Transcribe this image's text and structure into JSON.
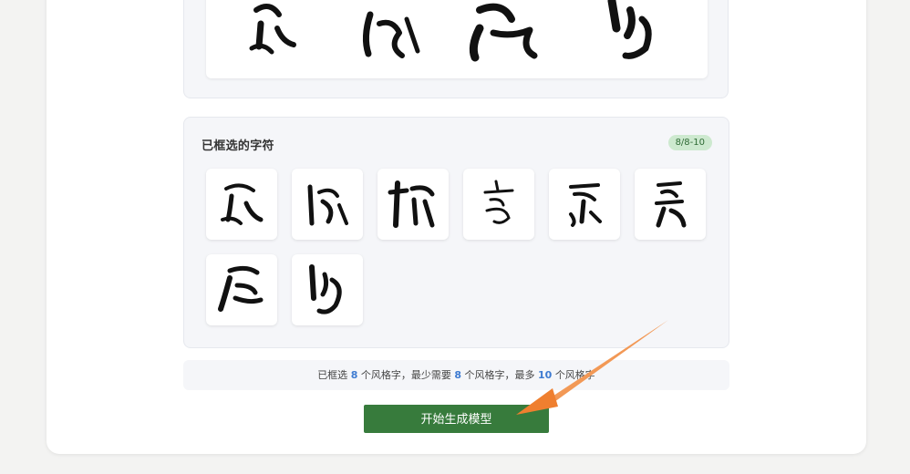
{
  "preview": {
    "image_alt": "calligraphy-preview"
  },
  "selected": {
    "title": "已框选的字符",
    "badge": "8/8-10",
    "tiles": [
      {
        "name": "char-tile-1"
      },
      {
        "name": "char-tile-2"
      },
      {
        "name": "char-tile-3"
      },
      {
        "name": "char-tile-4"
      },
      {
        "name": "char-tile-5"
      },
      {
        "name": "char-tile-6"
      },
      {
        "name": "char-tile-7"
      },
      {
        "name": "char-tile-8"
      }
    ]
  },
  "info": {
    "prefix": "已框选",
    "selected_count": "8",
    "mid1": "个风格字，最少需要",
    "min_count": "8",
    "mid2": "个风格字，最多",
    "max_count": "10",
    "suffix": "个风格字"
  },
  "actions": {
    "start_label": "开始生成模型"
  },
  "colors": {
    "accent_green": "#377b3c",
    "badge_bg": "#cde9cf",
    "number_blue": "#3e7bd1",
    "arrow_orange": "#ef8a3c"
  }
}
